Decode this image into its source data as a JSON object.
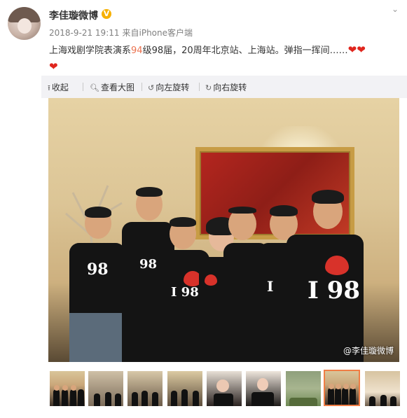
{
  "post": {
    "author": "李佳璇微博",
    "verified_badge": "V",
    "timestamp": "2018-9-21 19:11",
    "source": "来自iPhone客户端",
    "text_parts": {
      "part1": "上海戏剧学院表演系",
      "highlight": "94",
      "part2": "级98届，20周年北京站、上海站。弹指一挥间……",
      "hearts_line1": "❤❤",
      "hearts_line2": "❤"
    },
    "menu_icon": "chevron-down-icon"
  },
  "toolbar": {
    "collapse": "收起",
    "view_large": "查看大图",
    "rotate_left": "向左旋转",
    "rotate_right": "向右旋转",
    "icons": {
      "collapse": "upload-arrow-icon",
      "view_large": "magnifier-icon",
      "rotate_left": "rotate-left-icon",
      "rotate_right": "rotate-right-icon"
    }
  },
  "photo": {
    "watermark": "@李佳璇微博",
    "shirt_text": "I 98"
  },
  "thumbnails": {
    "count": 9,
    "active_index": 7
  },
  "colors": {
    "highlight": "#eb7350",
    "heart": "#e0261e",
    "verified": "#f6b000",
    "active_thumb_border": "#f07d45",
    "toolbar_bg": "#f2f2f5"
  }
}
